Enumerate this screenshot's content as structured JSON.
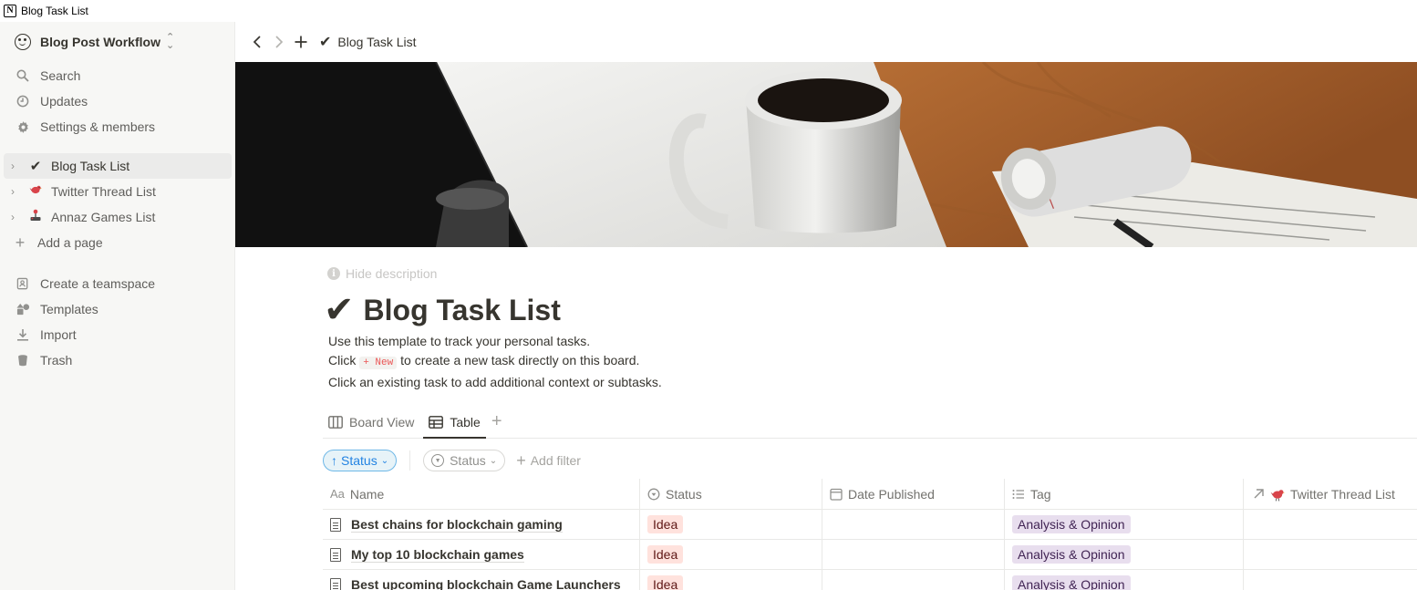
{
  "window": {
    "title": "Blog Task List",
    "app_icon": "N"
  },
  "sidebar": {
    "workspace": "Blog Post Workflow",
    "nav": [
      {
        "label": "Search",
        "icon": "search-icon"
      },
      {
        "label": "Updates",
        "icon": "clock-icon"
      },
      {
        "label": "Settings & members",
        "icon": "gear-icon"
      }
    ],
    "pages": [
      {
        "label": "Blog Task List",
        "emoji": "✔️",
        "active": true
      },
      {
        "label": "Twitter Thread List",
        "emoji": "🐦",
        "active": false
      },
      {
        "label": "Annaz Games List",
        "emoji": "🕹️",
        "active": false
      }
    ],
    "add_page": "Add a page",
    "footer": [
      {
        "label": "Create a teamspace",
        "icon": "teamspace-icon"
      },
      {
        "label": "Templates",
        "icon": "templates-icon"
      },
      {
        "label": "Import",
        "icon": "import-icon"
      },
      {
        "label": "Trash",
        "icon": "trash-icon"
      }
    ]
  },
  "topbar": {
    "breadcrumb": "Blog Task List"
  },
  "page": {
    "hide_description": "Hide description",
    "title": "Blog Task List",
    "description": {
      "line1": "Use this template to track your personal tasks.",
      "line2_pre": "Click",
      "line2_code": "+ New",
      "line2_post": "to create a new task directly on this board.",
      "line3": "Click an existing task to add additional context or subtasks."
    }
  },
  "views": {
    "tabs": [
      {
        "label": "Board View",
        "active": false
      },
      {
        "label": "Table",
        "active": true
      }
    ]
  },
  "filters": {
    "sort": "Status",
    "filter": "Status",
    "add_filter": "Add filter"
  },
  "table": {
    "columns": [
      {
        "label": "Name",
        "icon": "Aa"
      },
      {
        "label": "Status",
        "icon": "status-icon"
      },
      {
        "label": "Date Published",
        "icon": "calendar-icon"
      },
      {
        "label": "Tag",
        "icon": "list-icon"
      },
      {
        "label": "Twitter Thread List",
        "icon": "relation-arrow-icon"
      }
    ],
    "rows": [
      {
        "name": "Best chains for blockchain gaming",
        "status": "Idea",
        "date": "",
        "tag": "Analysis & Opinion",
        "twitter": ""
      },
      {
        "name": "My top 10 blockchain games",
        "status": "Idea",
        "date": "",
        "tag": "Analysis & Opinion",
        "twitter": ""
      },
      {
        "name": "Best upcoming blockchain Game Launchers",
        "status": "Idea",
        "date": "",
        "tag": "Analysis & Opinion",
        "twitter": ""
      }
    ]
  },
  "colors": {
    "sidebar_bg": "#f7f7f5",
    "status_tag_bg": "#ffe2dd",
    "category_tag_bg": "#e8deee",
    "accent_blue": "#2383e2"
  }
}
